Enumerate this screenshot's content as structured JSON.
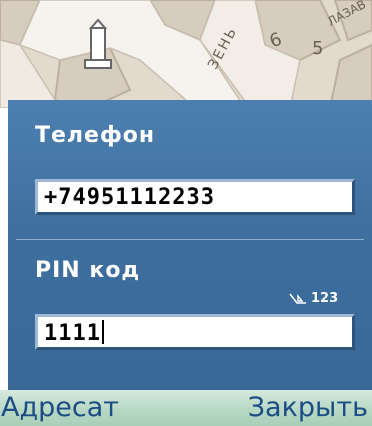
{
  "map": {
    "house_numbers": [
      "6",
      "5"
    ],
    "street_label": "ЗЕНЬ",
    "corner_label": "ЛАЗАВ"
  },
  "dialog": {
    "phone": {
      "label": "Телефон",
      "value": "+74951112233"
    },
    "pin": {
      "label": "PIN код",
      "value": "1111"
    },
    "input_mode": {
      "icon": "pencil-abc-icon",
      "label": "123"
    }
  },
  "softkeys": {
    "left": "Адресат",
    "right": "Закрыть"
  },
  "colors": {
    "dialog_bg": "#3f6f9f",
    "softkey_bg": "#b7d8c4",
    "softkey_text": "#1c4c84",
    "map_bg": "#e4ddd2"
  }
}
